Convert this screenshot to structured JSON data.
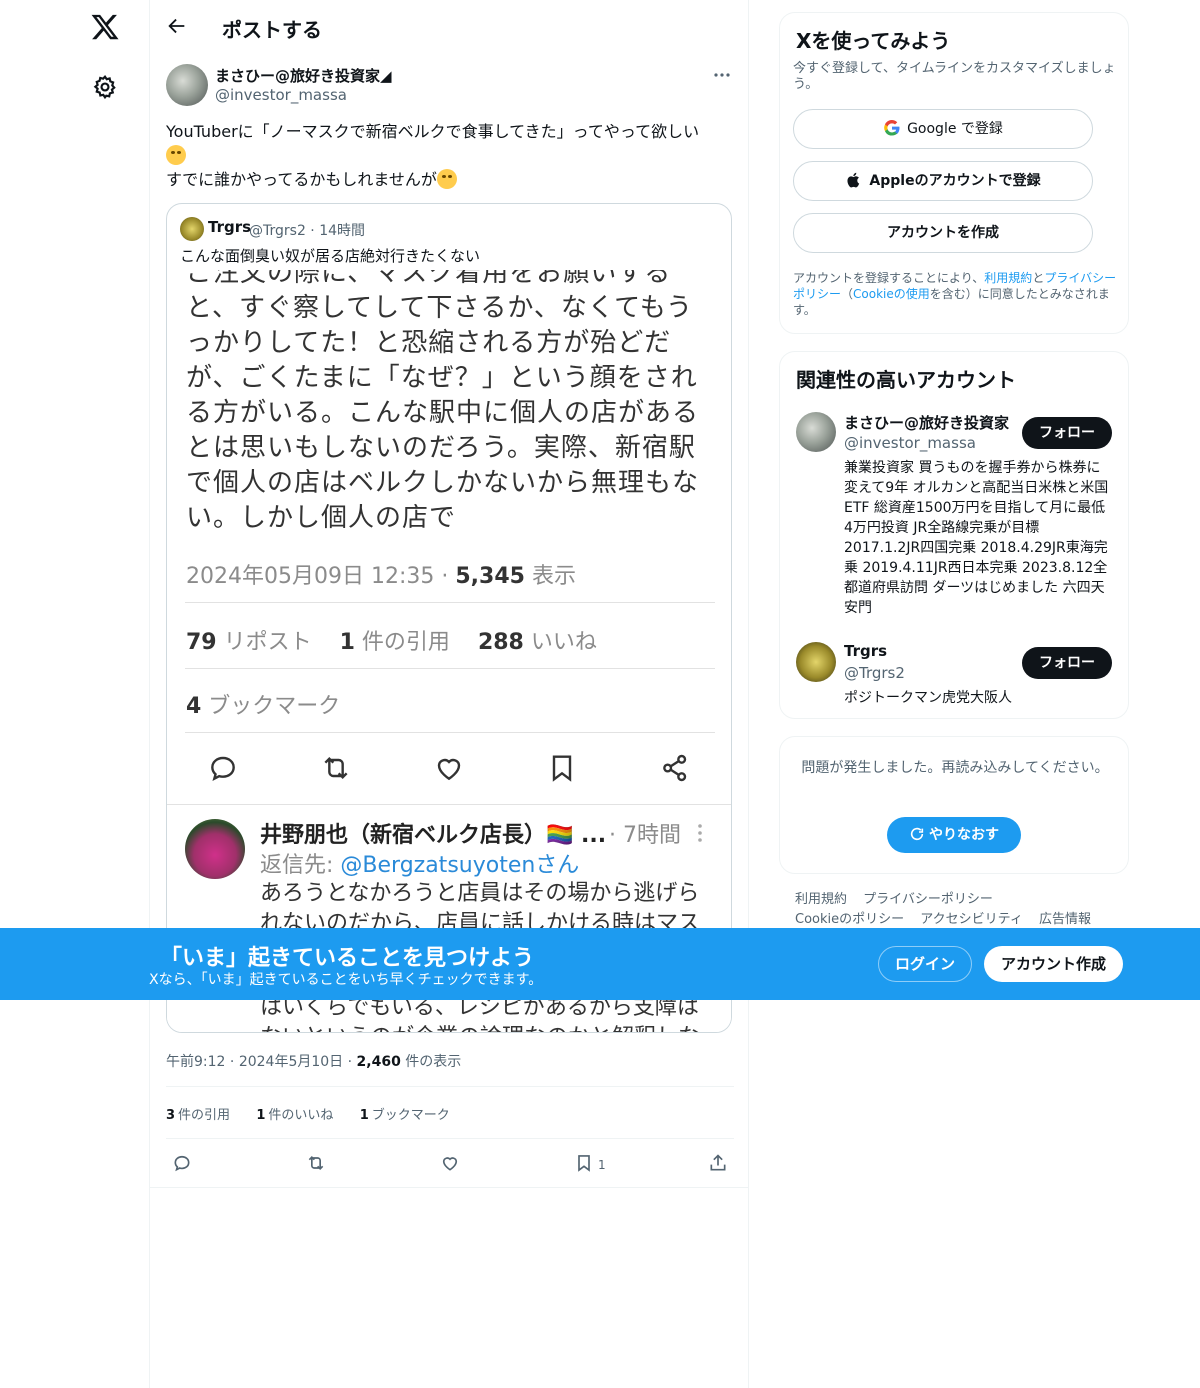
{
  "header": {
    "title": "ポストする"
  },
  "post": {
    "author_name": "まさひー@旅好き投資家◢",
    "author_handle": "@investor_massa",
    "text_line1": "YouTuberに「ノーマスクで新宿ベルクで食事してきた」ってやって欲しい",
    "text_line3": "すでに誰かやってるかもしれませんが",
    "meta_time": "午前9:12",
    "meta_date": "2024年5月10日",
    "meta_views_num": "2,460",
    "meta_views_label": "件の表示",
    "stats": {
      "quotes_num": "3",
      "quotes_label": "件の引用",
      "likes_num": "1",
      "likes_label": "件のいいね",
      "bookmarks_num": "1",
      "bookmarks_label": "ブックマーク"
    },
    "bookmark_count": "1"
  },
  "quote": {
    "name": "Trgrs",
    "meta": "@Trgrs2 · 14時間",
    "text": "こんな面倒臭い奴が居る店絶対行きたくない",
    "screenshot": {
      "body": "ご注文の際に、マスク着用をお願いすると、すぐ察してして下さるか、なくてもうっかりしてた！と恐縮される方が殆どだが、ごくたまに「なぜ？」という顔をされる方がいる。こんな駅中に個人の店があるとは思いもしないのだろう。実際、新宿駅で個人の店はベルクしかないから無理もない。しかし個人の店で",
      "datetime": "2024年05月09日 12:35 · ",
      "views_num": "5,345",
      "views_label": " 表示",
      "reposts_num": "79",
      "reposts_label": " リポスト",
      "quotes_num": "1",
      "quotes_label": " 件の引用",
      "likes_num": "288",
      "likes_label": " いいね",
      "bookmarks_num": "4",
      "bookmarks_label": " ブックマーク",
      "reply_name": "井野朋也（新宿ベルク店長）🏳️‍🌈 ...",
      "reply_time": "· 7時間",
      "reply_to_label": "返信先: ",
      "reply_to_handle": "@Bergzatsuyotenさん",
      "reply_body": "あろうとなかろうと店員はその場から逃げられないのだから、店員に話しかける時はマス",
      "reply_body2": "はいくらでもいる、レシピがあるから支障はないというのが企業の論理なのかと解釈しない"
    }
  },
  "signup": {
    "title": "Xを使ってみよう",
    "subtitle": "今すぐ登録して、タイムラインをカスタマイズしましょう。",
    "google_label": "Google で登録",
    "apple_label": "Appleのアカウントで登録",
    "create_label": "アカウントを作成",
    "legal_prefix": "アカウントを登録することにより、",
    "legal_terms": "利用規約",
    "legal_and": "と",
    "legal_privacy": "プライバシーポリシー",
    "legal_paren_open": "（",
    "legal_cookie": "Cookieの使用",
    "legal_suffix": "を含む）に同意したとみなされます。"
  },
  "related": {
    "title": "関連性の高いアカウント",
    "accounts": [
      {
        "name": "まさひー@旅好き投資家",
        "handle": "@investor_massa",
        "bio": "兼業投資家 買うものを握手券から株券に変えて9年 オルカンと高配当日米株と米国ETF 総資産1500万円を目指して月に最低4万円投資 JR全路線完乗が目標 2017.1.2JR四国完乗 2018.4.29JR東海完乗 2019.4.11JR西日本完乗 2023.8.12全都道府県訪問 ダーツはじめました 六四天安門",
        "follow_label": "フォロー"
      },
      {
        "name": "Trgrs",
        "handle": "@Trgrs2",
        "bio": "ポジトークマン虎党大阪人",
        "follow_label": "フォロー"
      }
    ]
  },
  "error": {
    "message": "問題が発生しました。再読み込みしてください。",
    "retry_label": "やりなおす"
  },
  "footer": {
    "links": [
      "利用規約",
      "プライバシーポリシー",
      "Cookieのポリシー",
      "アクセシビリティ",
      "広告情報"
    ]
  },
  "banner": {
    "headline": "「いま」起きていることを見つけよう",
    "subline": "Xなら、「いま」起きていることをいち早くチェックできます。",
    "login_label": "ログイン",
    "create_label": "アカウント作成"
  },
  "colors": {
    "accent": "#1d9bf0",
    "text": "#0f1419",
    "muted": "#536471",
    "border": "#eff3f4"
  }
}
